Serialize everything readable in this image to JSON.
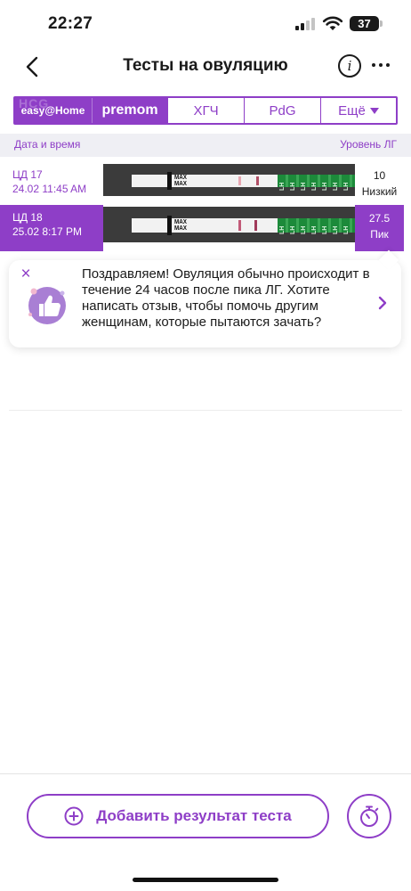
{
  "status_bar": {
    "time": "22:27",
    "battery": "37"
  },
  "nav": {
    "title": "Тесты на овуляцию",
    "info_label": "i"
  },
  "tabs": {
    "easy_home": "easy@Home",
    "premom": "premom",
    "hcg": "ХГЧ",
    "pdg": "PdG",
    "more": "Ещё"
  },
  "list_header": {
    "date_time": "Дата и время",
    "lh_level": "Уровень ЛГ"
  },
  "rows": [
    {
      "cycle_day": "ЦД 17",
      "datetime": "24.02 11:45 AM",
      "value": "10",
      "level": "Низкий",
      "selected": false
    },
    {
      "cycle_day": "ЦД 18",
      "datetime": "25.02 8:17 PM",
      "value": "27.5",
      "level": "Пик",
      "selected": true
    }
  ],
  "strip_text": {
    "max": "MAX",
    "lh": "LH"
  },
  "toast": {
    "close": "×",
    "message": "Поздравляем! Овуляция обычно происходит в течение 24 часов после пика ЛГ. Хотите написать отзыв, чтобы помочь другим женщинам, которые пытаются зачать?"
  },
  "bottom": {
    "add_result": "Добавить результат теста"
  },
  "colors": {
    "accent": "#8e3ec7",
    "header_bg": "#efeff4",
    "strip_green": "#1c8a3a"
  },
  "icons": {
    "back": "chevron-left-icon",
    "info": "info-icon",
    "more": "more-horizontal-icon",
    "dropdown": "triangle-down-icon",
    "close": "close-icon",
    "thumbs_up": "thumbs-up-icon",
    "chevron_right": "chevron-right-icon",
    "add": "plus-circle-icon",
    "timer": "stopwatch-icon"
  }
}
